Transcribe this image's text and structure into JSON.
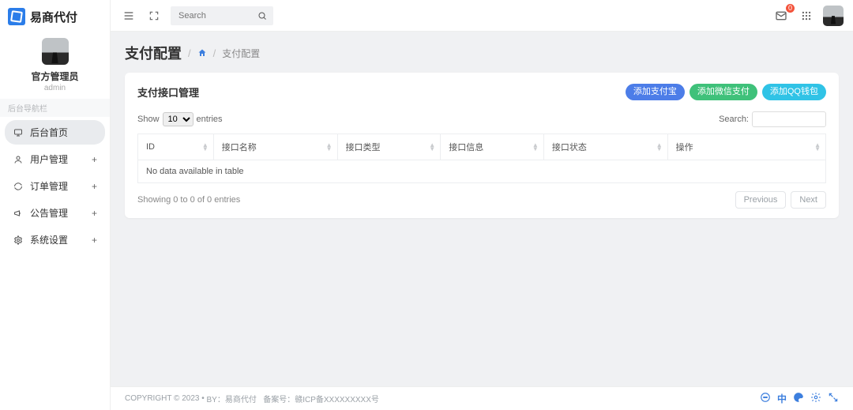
{
  "brand": {
    "name": "易商代付"
  },
  "profile": {
    "display_name": "官方管理员",
    "username": "admin"
  },
  "sidebar": {
    "section_label": "后台导航栏",
    "items": [
      {
        "label": "后台首页",
        "icon": "monitor-icon",
        "expandable": false,
        "active": true
      },
      {
        "label": "用户管理",
        "icon": "user-icon",
        "expandable": true,
        "active": false
      },
      {
        "label": "订单管理",
        "icon": "refresh-icon",
        "expandable": true,
        "active": false
      },
      {
        "label": "公告管理",
        "icon": "megaphone-icon",
        "expandable": true,
        "active": false
      },
      {
        "label": "系统设置",
        "icon": "gear-icon",
        "expandable": true,
        "active": false
      }
    ]
  },
  "topbar": {
    "search_placeholder": "Search",
    "mail_badge": "0"
  },
  "breadcrumb": {
    "title": "支付配置",
    "trail": "支付配置"
  },
  "card": {
    "title": "支付接口管理",
    "actions": {
      "add_alipay": "添加支付宝",
      "add_wechat": "添加微信支付",
      "add_qq": "添加QQ钱包"
    }
  },
  "datatable": {
    "length_prefix": "Show",
    "length_value": "10",
    "length_suffix": "entries",
    "search_label": "Search:",
    "columns": [
      "ID",
      "接口名称",
      "接口类型",
      "接口信息",
      "接口状态",
      "操作"
    ],
    "empty_text": "No data available in table",
    "info_text": "Showing 0 to 0 of 0 entries",
    "prev_label": "Previous",
    "next_label": "Next"
  },
  "footer": {
    "copyright_prefix": "COPYRIGHT © 2023",
    "by_label": "BY：",
    "by_link": "易商代付",
    "record_label": "备案号：",
    "record_link": "赣ICP备XXXXXXXXX号"
  }
}
